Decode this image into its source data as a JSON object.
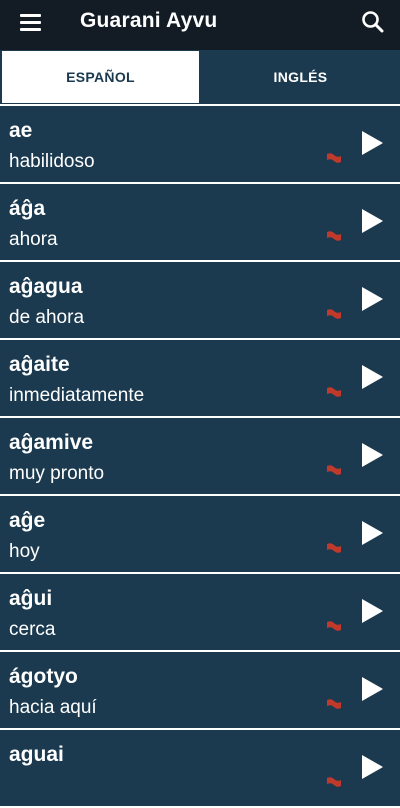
{
  "appbar": {
    "title": "Guarani Ayvu",
    "menu_icon": "menu-icon",
    "search_icon": "search-icon"
  },
  "tabs": [
    {
      "label": "ESPAÑOL",
      "selected": true
    },
    {
      "label": "INGLÉS",
      "selected": false
    }
  ],
  "colors": {
    "appbar": "#131c24",
    "row_background": "#1b3a4f",
    "flag": "#c0392b"
  },
  "entries": [
    {
      "word": "ae",
      "meaning": "habilidoso"
    },
    {
      "word": "áĝa",
      "meaning": "ahora"
    },
    {
      "word": "aĝagua",
      "meaning": "de ahora"
    },
    {
      "word": "aĝaite",
      "meaning": "inmediatamente"
    },
    {
      "word": "aĝamive",
      "meaning": "muy pronto"
    },
    {
      "word": "aĝe",
      "meaning": "hoy"
    },
    {
      "word": "aĝui",
      "meaning": "cerca"
    },
    {
      "word": "ágotyo",
      "meaning": "hacia aquí"
    },
    {
      "word": "aguai",
      "meaning": ""
    }
  ]
}
